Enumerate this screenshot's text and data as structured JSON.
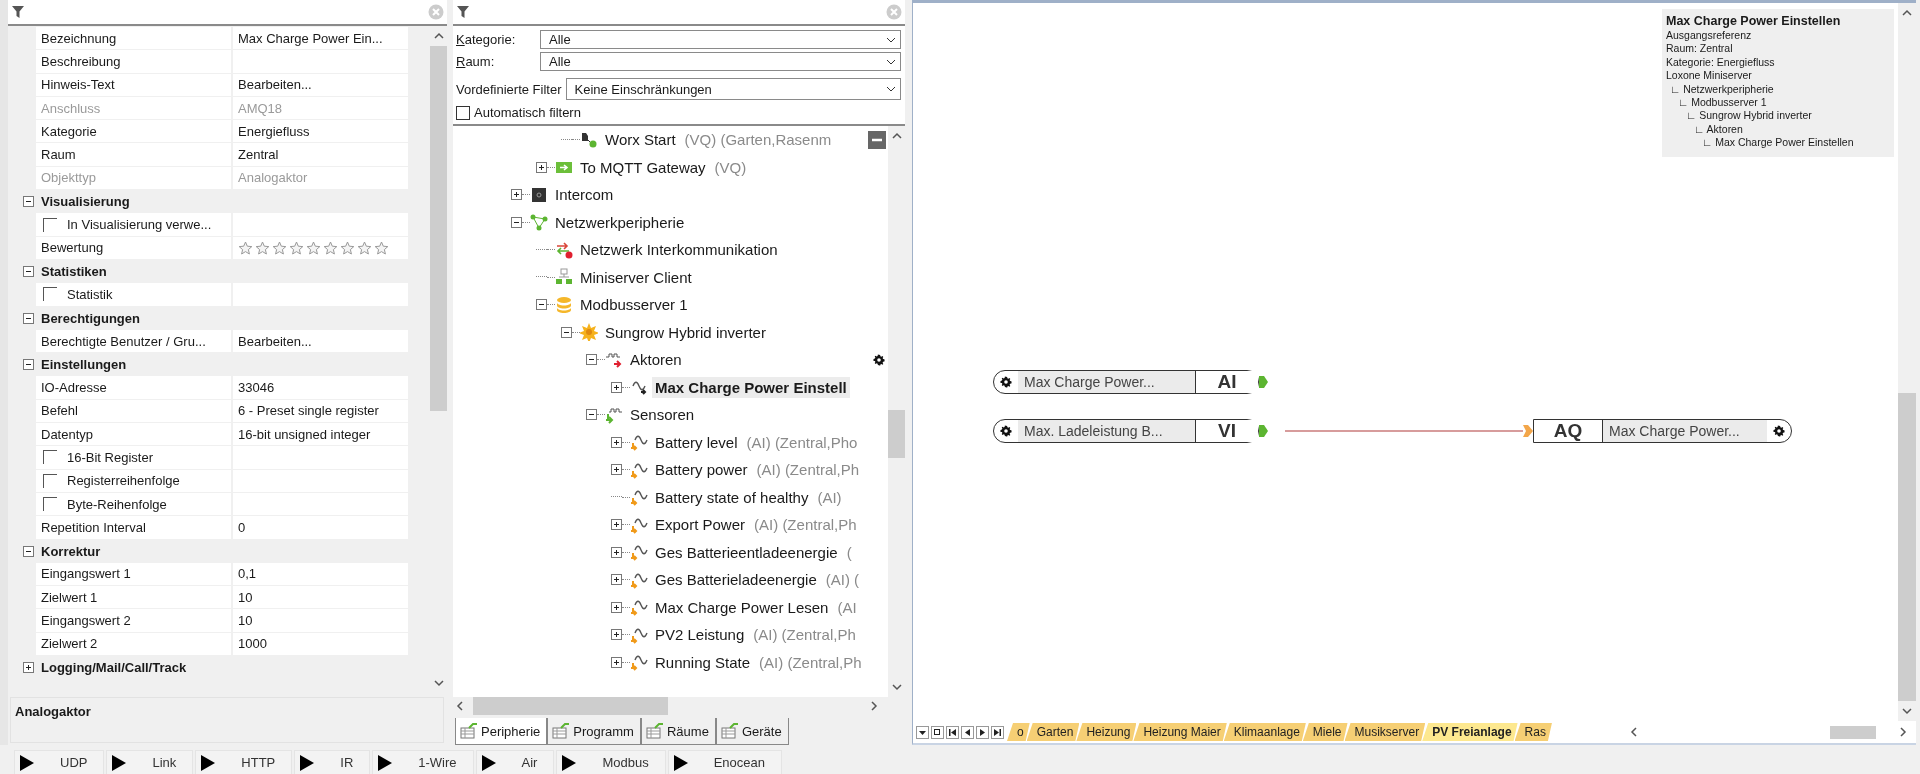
{
  "properties": {
    "rows": [
      {
        "kind": "field",
        "label": "Bezeichnung",
        "value": "Max Charge Power Ein...",
        "disabled": false
      },
      {
        "kind": "field",
        "label": "Beschreibung",
        "disabled": false
      },
      {
        "kind": "field",
        "label": "Hinweis-Text",
        "value": "Bearbeiten...",
        "disabled": false
      },
      {
        "kind": "field",
        "label": "Anschluss",
        "value": "AMQ18",
        "disabled": true
      },
      {
        "kind": "field",
        "label": "Kategorie",
        "value": "Energiefluss",
        "disabled": false
      },
      {
        "kind": "field",
        "label": "Raum",
        "value": "Zentral",
        "disabled": false
      },
      {
        "kind": "field",
        "label": "Objekttyp",
        "value": "Analogaktor",
        "disabled": true
      },
      {
        "kind": "group",
        "label": "Visualisierung",
        "expanded": true
      },
      {
        "kind": "check",
        "label": "In Visualisierung verwe...",
        "checked": false
      },
      {
        "kind": "rating",
        "label": "Bewertung",
        "stars": 0
      },
      {
        "kind": "group",
        "label": "Statistiken",
        "expanded": true
      },
      {
        "kind": "check",
        "label": "Statistik",
        "checked": false
      },
      {
        "kind": "group",
        "label": "Berechtigungen",
        "expanded": true
      },
      {
        "kind": "field",
        "label": "Berechtigte Benutzer / Gru...",
        "value": "Bearbeiten...",
        "disabled": false
      },
      {
        "kind": "group",
        "label": "Einstellungen",
        "expanded": true
      },
      {
        "kind": "field",
        "label": "IO-Adresse",
        "value": "33046",
        "disabled": false
      },
      {
        "kind": "field",
        "label": "Befehl",
        "value": "6 - Preset single register",
        "disabled": false
      },
      {
        "kind": "field",
        "label": "Datentyp",
        "value": "16-bit unsigned integer",
        "disabled": false
      },
      {
        "kind": "check",
        "label": "16-Bit Register",
        "checked": false
      },
      {
        "kind": "check",
        "label": "Registerreihenfolge",
        "checked": false
      },
      {
        "kind": "check",
        "label": "Byte-Reihenfolge",
        "checked": false
      },
      {
        "kind": "field",
        "label": "Repetition Interval",
        "value": "0",
        "disabled": false
      },
      {
        "kind": "group",
        "label": "Korrektur",
        "expanded": true
      },
      {
        "kind": "field",
        "label": "Eingangswert 1",
        "value": "0,1",
        "disabled": false
      },
      {
        "kind": "field",
        "label": "Zielwert 1",
        "value": "10",
        "disabled": false
      },
      {
        "kind": "field",
        "label": "Eingangswert 2",
        "value": "10",
        "disabled": false
      },
      {
        "kind": "field",
        "label": "Zielwert 2",
        "value": "1000",
        "disabled": false
      },
      {
        "kind": "group",
        "label": "Logging/Mail/Call/Track",
        "expanded": false
      }
    ],
    "description": "Analogaktor"
  },
  "toolbar": [
    "UDP",
    "Link",
    "HTTP",
    "IR",
    "1-Wire",
    "Air",
    "Modbus",
    "Enocean"
  ],
  "filters": {
    "category": {
      "label": "Kategorie:",
      "value": "Alle"
    },
    "room": {
      "label": "Raum:",
      "value": "Alle"
    },
    "predefined": {
      "label": "Vordefinierte Filter",
      "value": "Keine Einschränkungen"
    },
    "auto_filter": {
      "label": "Automatisch filtern",
      "checked": false
    }
  },
  "tree": [
    {
      "children": [
        {
          "children": [
            {
              "label": "Worx Start",
              "suffix": "(VQ) (Garten,Rasenm",
              "kind": "virtual-output",
              "selected": false,
              "remove_button": true
            }
          ]
        },
        {
          "label": "To MQTT Gateway",
          "suffix": "(VQ)",
          "kind": "gateway",
          "expanded": false,
          "selected": false
        }
      ]
    },
    {
      "label": "Intercom",
      "kind": "intercom",
      "expanded": false,
      "selected": false
    },
    {
      "label": "Netzwerkperipherie",
      "kind": "network",
      "expanded": true,
      "selected": false,
      "children": [
        {
          "label": "Netzwerk Interkommunikation",
          "kind": "interconnect",
          "selected": false
        },
        {
          "label": "Miniserver Client",
          "kind": "client",
          "selected": false
        },
        {
          "label": "Modbusserver 1",
          "kind": "database",
          "expanded": true,
          "selected": false,
          "children": [
            {
              "label": "Sungrow Hybrid inverter",
              "kind": "device",
              "expanded": true,
              "selected": false,
              "children": [
                {
                  "label": "Aktoren",
                  "kind": "actuators",
                  "expanded": true,
                  "selected": false,
                  "settings_button": true,
                  "children": [
                    {
                      "label": "Max Charge Power Einstell",
                      "kind": "analog-output",
                      "expanded": false,
                      "selected": true
                    }
                  ]
                },
                {
                  "label": "Sensoren",
                  "kind": "sensors",
                  "expanded": true,
                  "selected": false,
                  "children": [
                    {
                      "label": "Battery level",
                      "suffix": "(AI) (Zentral,Pho",
                      "kind": "analog-input",
                      "expanded": false,
                      "selected": false
                    },
                    {
                      "label": "Battery power",
                      "suffix": "(AI) (Zentral,Ph",
                      "kind": "analog-input",
                      "expanded": false,
                      "selected": false
                    },
                    {
                      "label": "Battery state of healthy",
                      "suffix": "(AI)",
                      "kind": "analog-input",
                      "selected": false
                    },
                    {
                      "label": "Export Power",
                      "suffix": "(AI) (Zentral,Ph",
                      "kind": "analog-input",
                      "expanded": false,
                      "selected": false
                    },
                    {
                      "label": "Ges Batterieentladeenergie",
                      "suffix": "(",
                      "kind": "analog-input",
                      "expanded": false,
                      "selected": false
                    },
                    {
                      "label": "Ges Batterieladeenergie",
                      "suffix": "(AI) (",
                      "kind": "analog-input",
                      "expanded": false,
                      "selected": false
                    },
                    {
                      "label": "Max Charge Power Lesen",
                      "suffix": "(AI",
                      "kind": "analog-input",
                      "expanded": false,
                      "selected": false
                    },
                    {
                      "label": "PV2 Leistung",
                      "suffix": "(AI) (Zentral,Ph",
                      "kind": "analog-input",
                      "expanded": false,
                      "selected": false
                    },
                    {
                      "label": "Running State",
                      "suffix": "(AI) (Zentral,Ph",
                      "kind": "analog-input",
                      "expanded": false,
                      "selected": false
                    }
                  ]
                }
              ]
            }
          ]
        }
      ]
    }
  ],
  "view_tabs": [
    {
      "label": "Peripherie",
      "selected": true
    },
    {
      "label": "Programm",
      "selected": false
    },
    {
      "label": "Räume",
      "selected": false
    },
    {
      "label": "Geräte",
      "selected": false
    }
  ],
  "canvas": {
    "info": {
      "title": "Max Charge Power Einstellen",
      "lines": [
        "Ausgangsreferenz",
        "Raum: Zentral",
        "Kategorie: Energiefluss"
      ],
      "path": [
        "Loxone Miniserver",
        "∟ Netzwerkperipherie",
        "∟ Modbusserver 1",
        "∟ Sungrow Hybrid inverter",
        "∟ Aktoren",
        "∟ Max Charge Power Einstellen"
      ]
    },
    "blocks": [
      {
        "kind": "input",
        "label": "Max Charge Power...",
        "type": "AI"
      },
      {
        "kind": "input",
        "label": "Max. Ladeleistung B...",
        "type": "VI",
        "wired": true
      },
      {
        "kind": "output",
        "label": "Max Charge Power...",
        "type": "AQ"
      }
    ],
    "sheets": [
      {
        "label": "o",
        "selected": false
      },
      {
        "label": "Garten",
        "selected": false
      },
      {
        "label": "Heizung",
        "selected": false
      },
      {
        "label": "Heizung Maier",
        "selected": false
      },
      {
        "label": "Klimaanlage",
        "selected": false
      },
      {
        "label": "Miele",
        "selected": false
      },
      {
        "label": "Musikserver",
        "selected": false
      },
      {
        "label": "PV Freianlage",
        "selected": true
      },
      {
        "label": "Ras",
        "selected": false
      }
    ]
  }
}
